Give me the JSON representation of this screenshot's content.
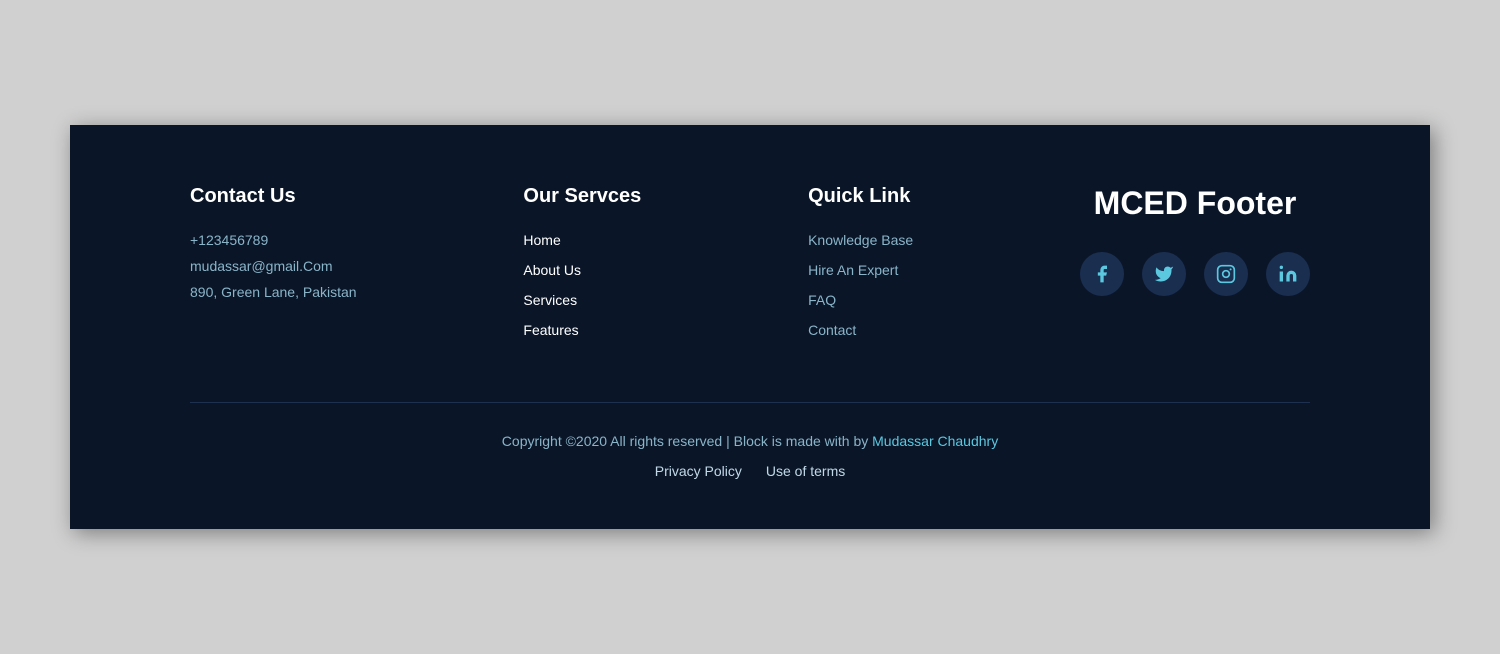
{
  "footer": {
    "contact": {
      "title": "Contact Us",
      "phone": "+123456789",
      "email": "mudassar@gmail.Com",
      "address": "890, Green Lane, Pakistan"
    },
    "services": {
      "title": "Our Servces",
      "links": [
        {
          "label": "Home"
        },
        {
          "label": "About Us"
        },
        {
          "label": "Services"
        },
        {
          "label": "Features"
        }
      ]
    },
    "quicklink": {
      "title": "Quick Link",
      "links": [
        {
          "label": "Knowledge Base"
        },
        {
          "label": "Hire An Expert"
        },
        {
          "label": "FAQ"
        },
        {
          "label": "Contact"
        }
      ]
    },
    "brand": {
      "title": "MCED Footer"
    },
    "social": [
      {
        "name": "facebook",
        "symbol": "f"
      },
      {
        "name": "twitter",
        "symbol": "t"
      },
      {
        "name": "instagram",
        "symbol": "i"
      },
      {
        "name": "linkedin",
        "symbol": "in"
      }
    ],
    "copyright": {
      "text": "Copyright ©2020 All rights reserved | Block is made with by ",
      "author": "Mudassar Chaudhry"
    },
    "bottomLinks": [
      {
        "label": "Privacy Policy"
      },
      {
        "label": "Use of terms"
      }
    ]
  }
}
